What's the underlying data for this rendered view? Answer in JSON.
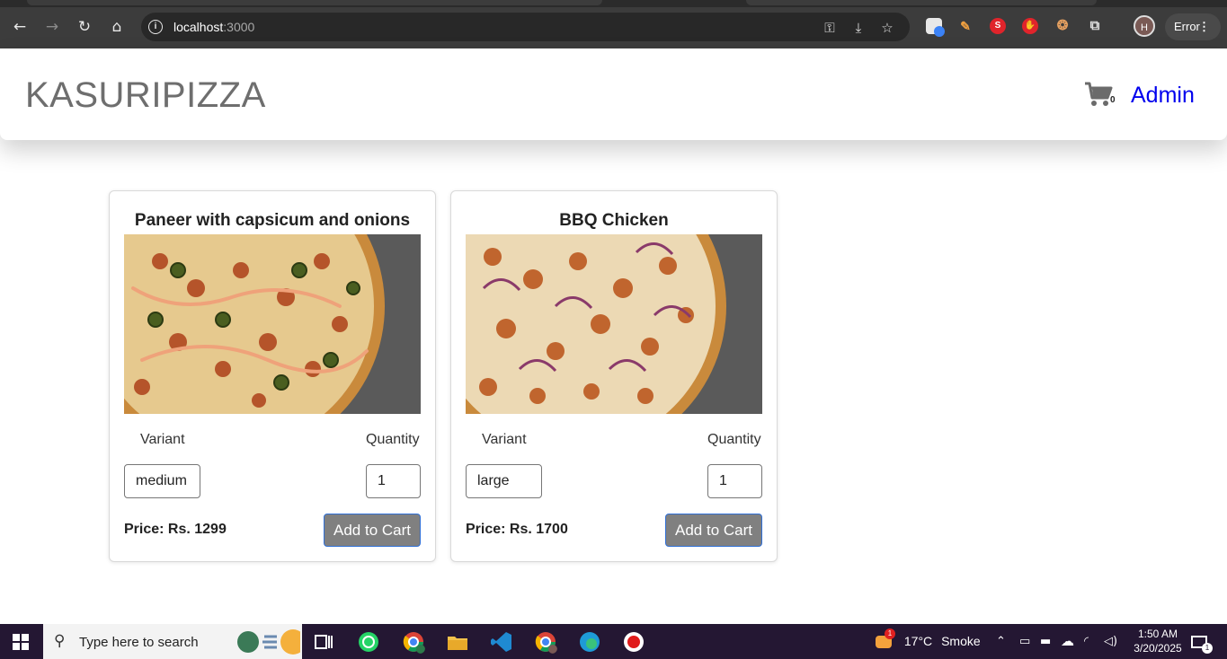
{
  "browser": {
    "url_host": "localhost",
    "url_port": ":3000",
    "profile_initial": "H",
    "error_label": "Error"
  },
  "navbar": {
    "brand": "KASURIPIZZA",
    "cart_count": "0",
    "admin_label": "Admin"
  },
  "pizzas": [
    {
      "name": "Paneer with capsicum and onions",
      "variant_label": "Variant",
      "quantity_label": "Quantity",
      "variant": "medium",
      "quantity": "1",
      "price": "Price: Rs. 1299",
      "button": "Add to Cart"
    },
    {
      "name": "BBQ Chicken",
      "variant_label": "Variant",
      "quantity_label": "Quantity",
      "variant": "large",
      "quantity": "1",
      "price": "Price: Rs. 1700",
      "button": "Add to Cart"
    }
  ],
  "taskbar": {
    "search_placeholder": "Type here to search",
    "weather_temp": "17°C",
    "weather_desc": "Smoke",
    "weather_badge": "1",
    "time": "1:50 AM",
    "date": "3/20/2025",
    "notification_count": "1"
  }
}
